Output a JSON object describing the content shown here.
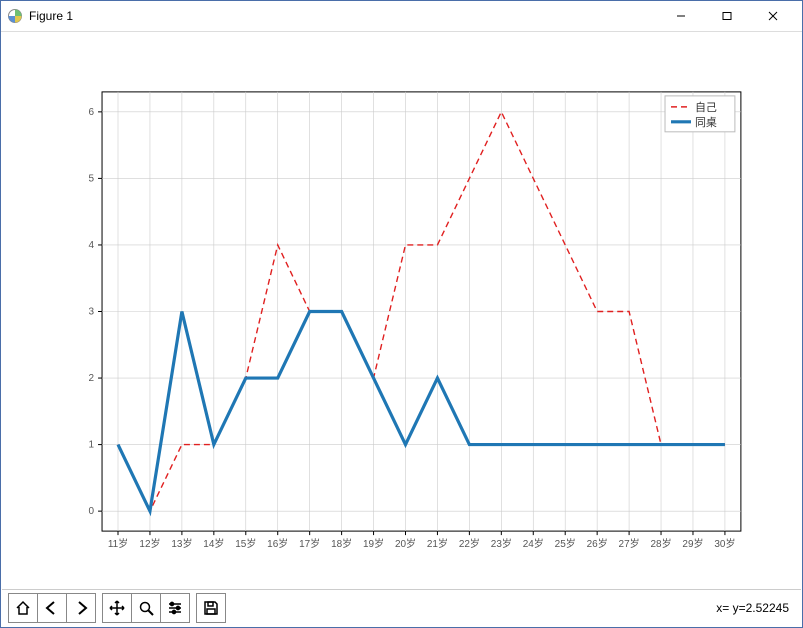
{
  "window": {
    "title": "Figure 1"
  },
  "toolbar": {
    "home": "home-icon",
    "back": "back-icon",
    "forward": "forward-icon",
    "pan": "pan-icon",
    "zoom": "zoom-icon",
    "configure": "configure-icon",
    "save": "save-icon"
  },
  "status": {
    "coords": "x= y=2.52245"
  },
  "chart_data": {
    "type": "line",
    "categories": [
      "11岁",
      "12岁",
      "13岁",
      "14岁",
      "15岁",
      "16岁",
      "17岁",
      "18岁",
      "19岁",
      "20岁",
      "21岁",
      "22岁",
      "23岁",
      "24岁",
      "25岁",
      "26岁",
      "27岁",
      "28岁",
      "29岁",
      "30岁"
    ],
    "series": [
      {
        "name": "自己",
        "style": "red-dashed",
        "values": [
          1,
          0,
          1,
          1,
          2,
          4,
          3,
          3,
          2,
          4,
          4,
          5,
          6,
          5,
          4,
          3,
          3,
          1,
          1,
          1
        ]
      },
      {
        "name": "同桌",
        "style": "blue-solid",
        "values": [
          1,
          0,
          3,
          1,
          2,
          2,
          3,
          3,
          2,
          1,
          2,
          1,
          1,
          1,
          1,
          1,
          1,
          1,
          1,
          1
        ]
      }
    ],
    "y_ticks": [
      0,
      1,
      2,
      3,
      4,
      5,
      6
    ],
    "ylim": [
      -0.3,
      6.3
    ],
    "xlabel": "",
    "ylabel": "",
    "title": "",
    "legend_position": "upper right"
  }
}
